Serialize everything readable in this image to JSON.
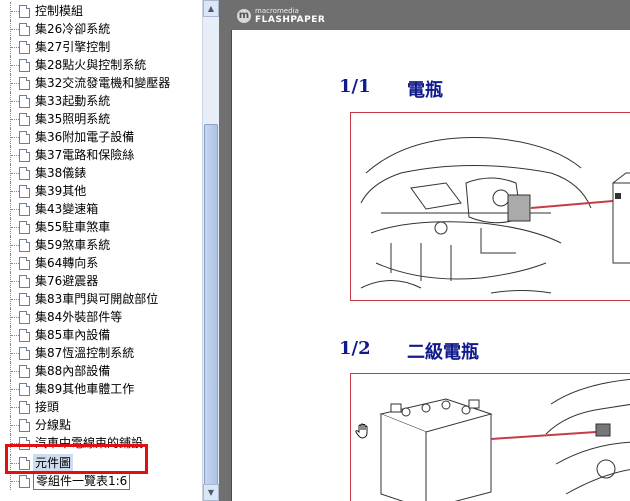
{
  "tree": {
    "items": [
      {
        "label": "控制模組"
      },
      {
        "label": "集26冷卻系統"
      },
      {
        "label": "集27引擎控制"
      },
      {
        "label": "集28點火與控制系統"
      },
      {
        "label": "集32交流發電機和變壓器"
      },
      {
        "label": "集33起動系統"
      },
      {
        "label": "集35照明系統"
      },
      {
        "label": "集36附加電子設備"
      },
      {
        "label": "集37電路和保險絲"
      },
      {
        "label": "集38儀錶"
      },
      {
        "label": "集39其他"
      },
      {
        "label": "集43變速箱"
      },
      {
        "label": "集55駐車煞車"
      },
      {
        "label": "集59煞車系統"
      },
      {
        "label": "集64轉向系"
      },
      {
        "label": "集76避震器"
      },
      {
        "label": "集83車門與可開啟部位"
      },
      {
        "label": "集84外裝部件等"
      },
      {
        "label": "集85車內設備"
      },
      {
        "label": "集87恆溫控制系統"
      },
      {
        "label": "集88內部設備"
      },
      {
        "label": "集89其他車體工作"
      },
      {
        "label": "接頭"
      },
      {
        "label": "分線點"
      },
      {
        "label": "汽車中電線束的鋪設"
      },
      {
        "label": "元件圖"
      },
      {
        "label": "零組件一覽表1:6"
      }
    ],
    "selected_index": 25
  },
  "viewer": {
    "brand_small": "macromedia",
    "brand_big": "FLASHPAPER",
    "sections": [
      {
        "number": "1/1",
        "title": "電瓶"
      },
      {
        "number": "1/2",
        "title": "二級電瓶"
      }
    ]
  },
  "colors": {
    "heading": "#101a8c",
    "figure_border": "#c63b48",
    "highlight": "#e01010",
    "viewer_bg": "#707070"
  }
}
